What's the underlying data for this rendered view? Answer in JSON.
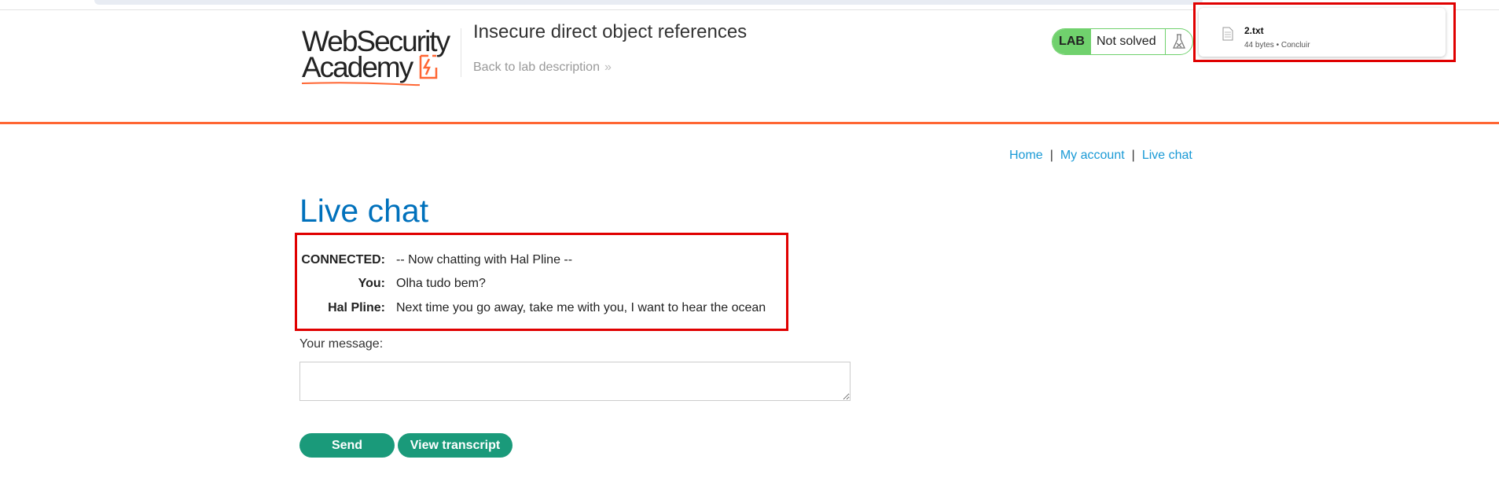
{
  "header": {
    "logo_line1": "WebSecurity",
    "logo_line2": "Academy",
    "lab_title": "Insecure direct object references",
    "back_link": "Back to lab description",
    "lab_badge": "LAB",
    "lab_status": "Not solved"
  },
  "download": {
    "file_name": "2.txt",
    "file_meta": "44 bytes • Concluir"
  },
  "nav": {
    "items": [
      "Home",
      "My account",
      "Live chat"
    ],
    "separator": "|"
  },
  "main": {
    "title": "Live chat",
    "chat": [
      {
        "who": "CONNECTED:",
        "msg": "-- Now chatting with Hal Pline --"
      },
      {
        "who": "You:",
        "msg": "Olha tudo bem?"
      },
      {
        "who": "Hal Pline:",
        "msg": "Next time you go away, take me with you, I want to hear the ocean"
      }
    ],
    "message_label": "Your message:",
    "message_value": "",
    "send_label": "Send",
    "transcript_label": "View transcript"
  },
  "colors": {
    "accent_orange": "#ff6633",
    "link_blue": "#1a9ad6",
    "title_blue": "#0071bc",
    "button_green": "#1a9a7a",
    "lab_green": "#70d16d",
    "highlight_red": "#e00000"
  }
}
